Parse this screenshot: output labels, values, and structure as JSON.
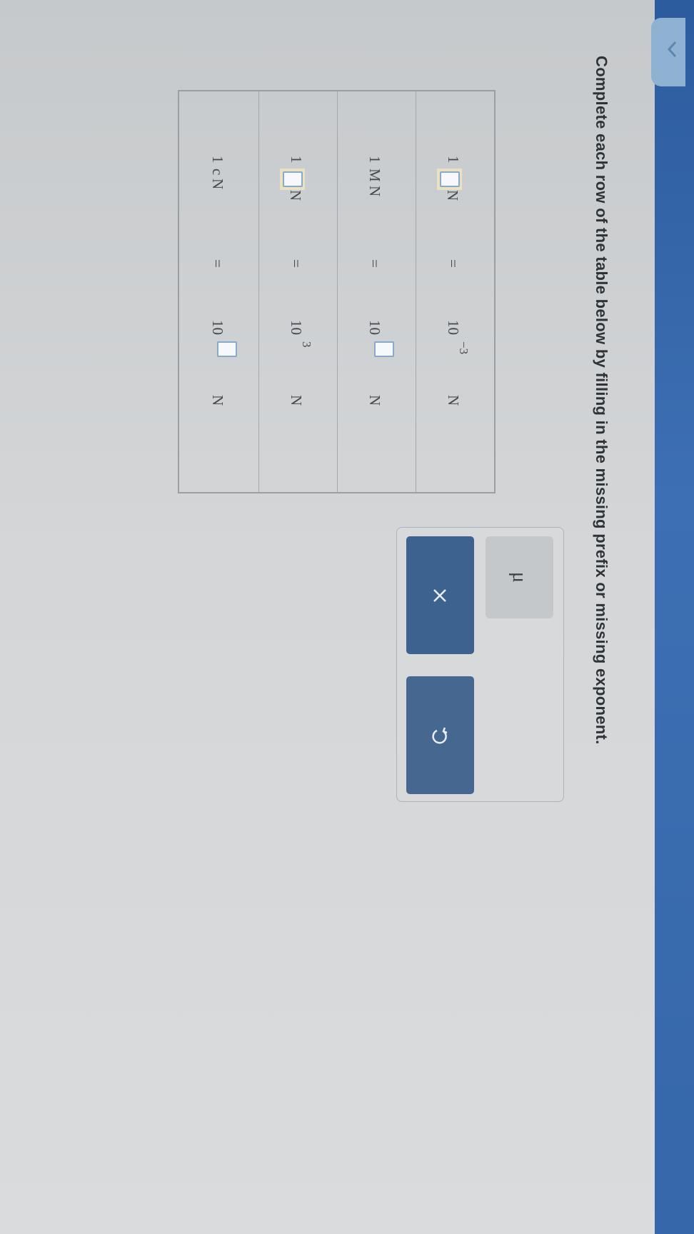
{
  "instruction": "Complete each row of the table below by filling in the missing prefix or missing exponent.",
  "table": {
    "rows": [
      {
        "left_number": "1",
        "left_prefix": "",
        "left_unit": "N",
        "equals": "=",
        "base": "10",
        "exponent": "−3",
        "right_unit": "N"
      },
      {
        "left_number": "1",
        "left_prefix": "M",
        "left_unit": "N",
        "equals": "=",
        "base": "10",
        "exponent": "",
        "right_unit": "N"
      },
      {
        "left_number": "1",
        "left_prefix": "",
        "left_unit": "N",
        "equals": "=",
        "base": "10",
        "exponent": "3",
        "right_unit": "N"
      },
      {
        "left_number": "1",
        "left_prefix": "c",
        "left_unit": "N",
        "equals": "=",
        "base": "10",
        "exponent": "",
        "right_unit": "N"
      }
    ]
  },
  "palette": {
    "keys": [
      "μ"
    ],
    "clear_icon": "x-icon",
    "undo_icon": "undo-icon"
  },
  "colors": {
    "accent": "#3e6290",
    "header_band": "#3567aa",
    "back_tab": "#8fb2d2"
  }
}
